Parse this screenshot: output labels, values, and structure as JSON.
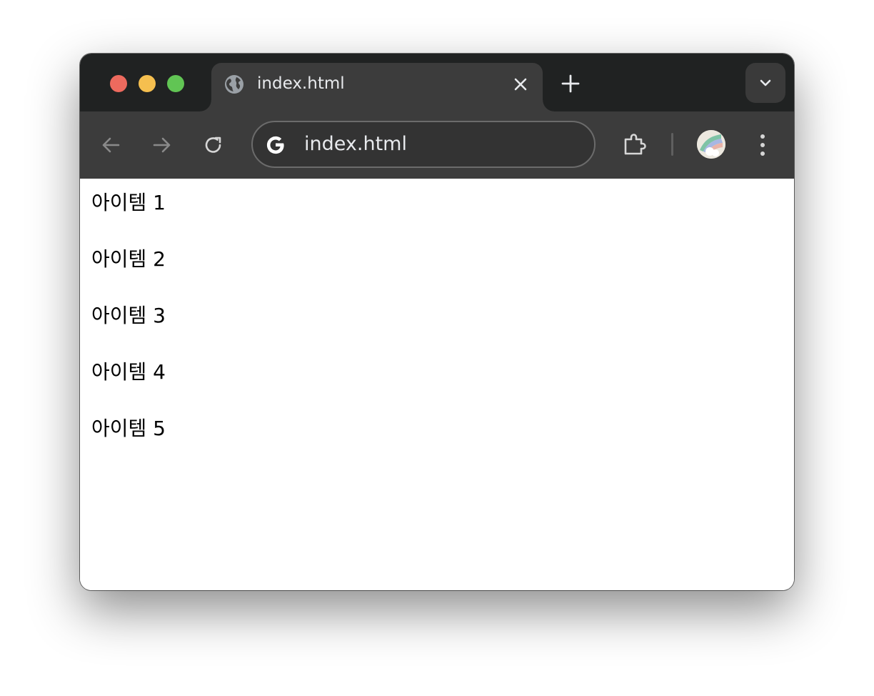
{
  "tab": {
    "title": "index.html",
    "favicon": "globe-icon"
  },
  "toolbar": {
    "url": "index.html"
  },
  "content": {
    "items": [
      "아이템 1",
      "아이템 2",
      "아이템 3",
      "아이템 4",
      "아이템 5"
    ]
  },
  "colors": {
    "tabstrip": "#202222",
    "toolbar": "#3c3c3c",
    "close_red": "#ed6a5e",
    "minimize_yellow": "#f5bf4f",
    "zoom_green": "#61c554"
  }
}
